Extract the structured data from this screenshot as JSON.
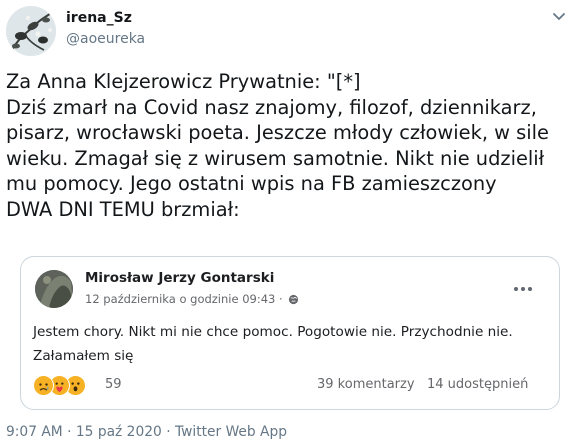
{
  "author": {
    "display_name": "irena_Sz",
    "handle": "@aoeureka"
  },
  "tweet": {
    "lines": [
      "Za Anna Klejzerowicz Prywatnie: \"[*]",
      "Dziś zmarł na Covid nasz znajomy, filozof, dziennikarz,",
      "pisarz, wrocławski poeta. Jeszcze młody człowiek, w sile",
      "wieku. Zmagał się z wirusem samotnie. Nikt nie udzielił",
      "mu pomocy. Jego ostatni wpis na FB zamieszczony",
      "DWA DNI TEMU brzmiał:"
    ]
  },
  "embedded_post": {
    "author": "Mirosław Jerzy Gontarski",
    "date": "12 października o godzinie 09:43 ·",
    "text_lines": [
      "Jestem chory. Nikt mi nie chce pomoc. Pogotowie nie. Przychodnie nie.",
      "Załamałem się"
    ],
    "reaction_icons": [
      "sad-reaction-icon",
      "care-reaction-icon",
      "wow-reaction-icon"
    ],
    "reaction_count": "59",
    "comments": "39 komentarzy",
    "shares": "14 udostępnień"
  },
  "footer": {
    "time": "9:07 AM",
    "separator": "·",
    "date": "15 paź 2020",
    "source": "Twitter Web App"
  },
  "colors": {
    "secondary_text": "#657786",
    "card_border": "#ccd6dd",
    "reaction_yellow": "#f7b125"
  }
}
